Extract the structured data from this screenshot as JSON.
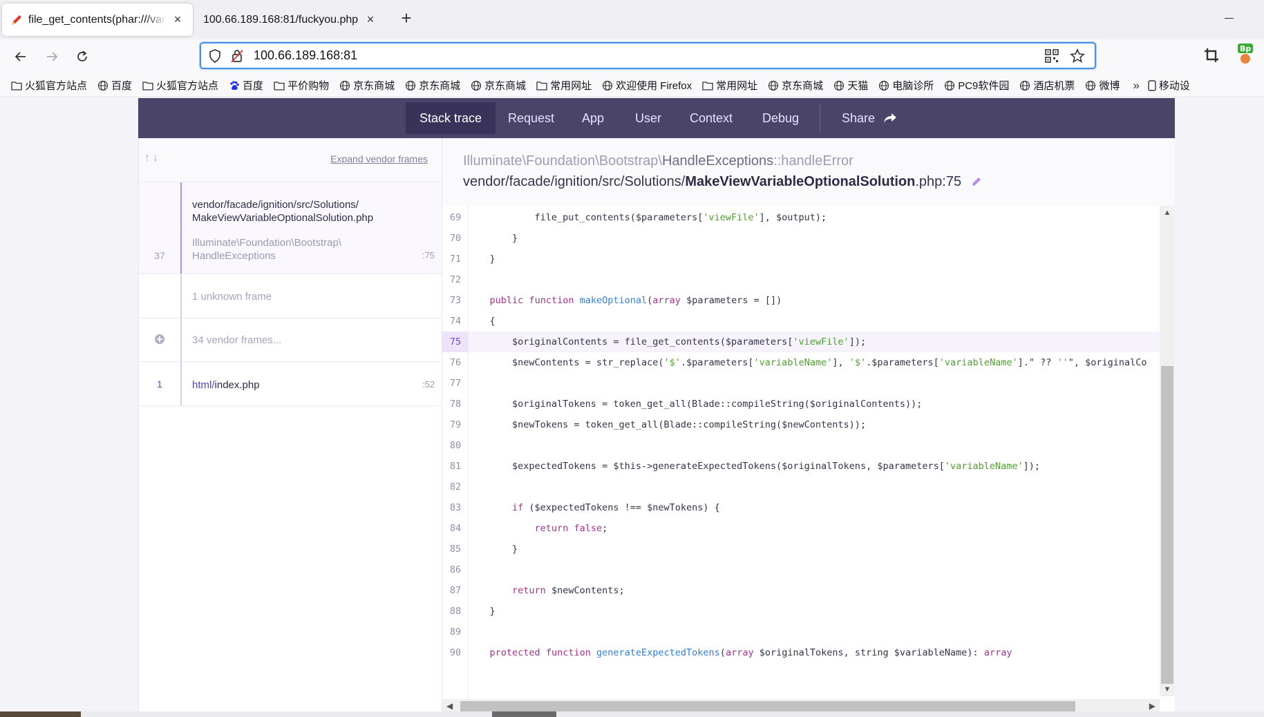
{
  "browser": {
    "tabs": [
      {
        "title": "file_get_contents(phar:///var/www/html",
        "active": true
      },
      {
        "title": "100.66.189.168:81/fuckyou.php",
        "active": false
      }
    ],
    "new_tab_label": "+",
    "url": "100.66.189.168:81",
    "bookmarks": [
      {
        "label": "火狐官方站点",
        "icon": "folder-icon"
      },
      {
        "label": "百度",
        "icon": "globe-icon"
      },
      {
        "label": "火狐官方站点",
        "icon": "folder-icon"
      },
      {
        "label": "百度",
        "icon": "baidu-icon"
      },
      {
        "label": "平价购物",
        "icon": "folder-icon"
      },
      {
        "label": "京东商城",
        "icon": "globe-icon"
      },
      {
        "label": "京东商城",
        "icon": "globe-icon"
      },
      {
        "label": "京东商城",
        "icon": "globe-icon"
      },
      {
        "label": "常用网址",
        "icon": "folder-icon"
      },
      {
        "label": "欢迎使用 Firefox",
        "icon": "globe-icon"
      },
      {
        "label": "常用网址",
        "icon": "folder-icon"
      },
      {
        "label": "京东商城",
        "icon": "globe-icon"
      },
      {
        "label": "天猫",
        "icon": "globe-icon"
      },
      {
        "label": "电脑诊所",
        "icon": "globe-icon"
      },
      {
        "label": "PC9软件园",
        "icon": "globe-icon"
      },
      {
        "label": "酒店机票",
        "icon": "globe-icon"
      },
      {
        "label": "微博",
        "icon": "globe-icon"
      }
    ],
    "mobile_bookmarks": "移动设"
  },
  "ignition": {
    "tabs": [
      "Stack trace",
      "Request",
      "App",
      "User",
      "Context",
      "Debug"
    ],
    "active_tab": "Stack trace",
    "share_label": "Share",
    "expand_vendor": "Expand vendor frames",
    "frames": [
      {
        "number": "37",
        "file_dir": "vendor/facade/ignition/src/Solutions/",
        "file_name": "MakeViewVariableOptionalSolution.php",
        "class_ns": "Illuminate\\Foundation\\Bootstrap\\",
        "class_name": "HandleExceptions",
        "line": ":75"
      },
      {
        "label": "1 unknown frame"
      },
      {
        "label": "34 vendor frames..."
      },
      {
        "number": "1",
        "file_dir": "html/",
        "file_name": "index.php",
        "line": ":52"
      }
    ],
    "header": {
      "class_ns": "Illuminate\\Foundation\\Bootstrap\\",
      "class_name": "HandleExceptions",
      "method": "::handleError",
      "file_dir": "vendor/facade/ignition/src/Solutions/",
      "file_name": "MakeViewVariableOptionalSolution",
      "file_ext": ".php:75"
    },
    "highlight_line": "75",
    "code": [
      {
        "n": "69",
        "t": "            file_put_contents($parameters['viewFile'], $output);"
      },
      {
        "n": "70",
        "t": "        }"
      },
      {
        "n": "71",
        "t": "    }"
      },
      {
        "n": "72",
        "t": ""
      },
      {
        "n": "73",
        "t": "    public function makeOptional(array $parameters = [])"
      },
      {
        "n": "74",
        "t": "    {"
      },
      {
        "n": "75",
        "t": "        $originalContents = file_get_contents($parameters['viewFile']);"
      },
      {
        "n": "76",
        "t": "        $newContents = str_replace('$'.$parameters['variableName'], '$'.$parameters['variableName'].\" ?? ''\", $originalCo"
      },
      {
        "n": "77",
        "t": ""
      },
      {
        "n": "78",
        "t": "        $originalTokens = token_get_all(Blade::compileString($originalContents));"
      },
      {
        "n": "79",
        "t": "        $newTokens = token_get_all(Blade::compileString($newContents));"
      },
      {
        "n": "80",
        "t": ""
      },
      {
        "n": "81",
        "t": "        $expectedTokens = $this->generateExpectedTokens($originalTokens, $parameters['variableName']);"
      },
      {
        "n": "82",
        "t": ""
      },
      {
        "n": "83",
        "t": "        if ($expectedTokens !== $newTokens) {"
      },
      {
        "n": "84",
        "t": "            return false;"
      },
      {
        "n": "85",
        "t": "        }"
      },
      {
        "n": "86",
        "t": ""
      },
      {
        "n": "87",
        "t": "        return $newContents;"
      },
      {
        "n": "88",
        "t": "    }"
      },
      {
        "n": "89",
        "t": ""
      },
      {
        "n": "90",
        "t": "    protected function generateExpectedTokens(array $originalTokens, string $variableName): array"
      }
    ]
  },
  "colors": {
    "ignition_nav": "#4a4568",
    "ignition_active_tab": "#39335a",
    "highlight_accent": "#b58de6",
    "keyword": "#a0348a",
    "function": "#2f7fd6",
    "string": "#4d9f2e"
  }
}
